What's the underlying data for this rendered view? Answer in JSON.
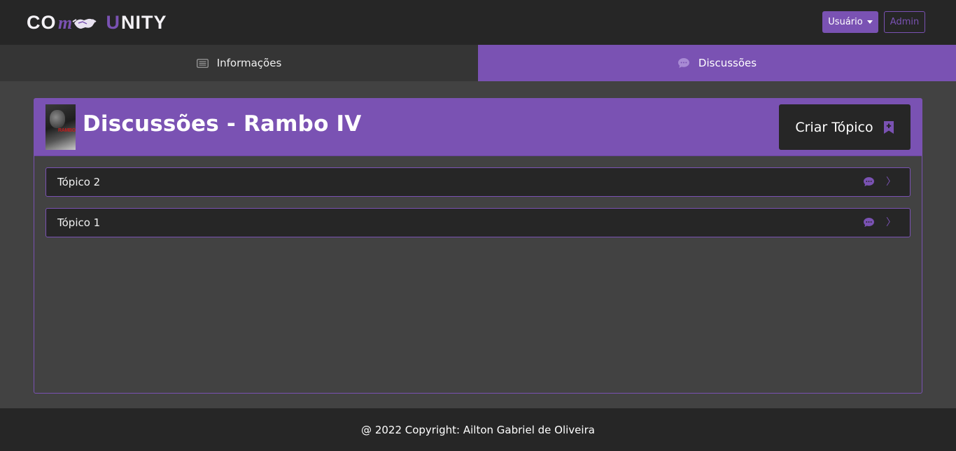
{
  "navbar": {
    "logo": {
      "left": "CO",
      "right": "NITY",
      "mid_letter": "U"
    },
    "user_button_label": "Usuário",
    "admin_button_label": "Admin"
  },
  "tabs": [
    {
      "label": "Informações",
      "icon": "list-icon",
      "active": false
    },
    {
      "label": "Discussões",
      "icon": "chat-icon",
      "active": true
    }
  ],
  "discussion": {
    "title": "Discussões - Rambo IV",
    "poster_text": "RAMBO",
    "create_button_label": "Criar Tópico",
    "topics": [
      {
        "label": "Tópico 2"
      },
      {
        "label": "Tópico 1"
      }
    ]
  },
  "footer": {
    "text": "@ 2022 Copyright: Ailton Gabriel de Oliveira"
  },
  "colors": {
    "accent": "#7a52b3",
    "dark": "#262626",
    "background": "#424242"
  }
}
